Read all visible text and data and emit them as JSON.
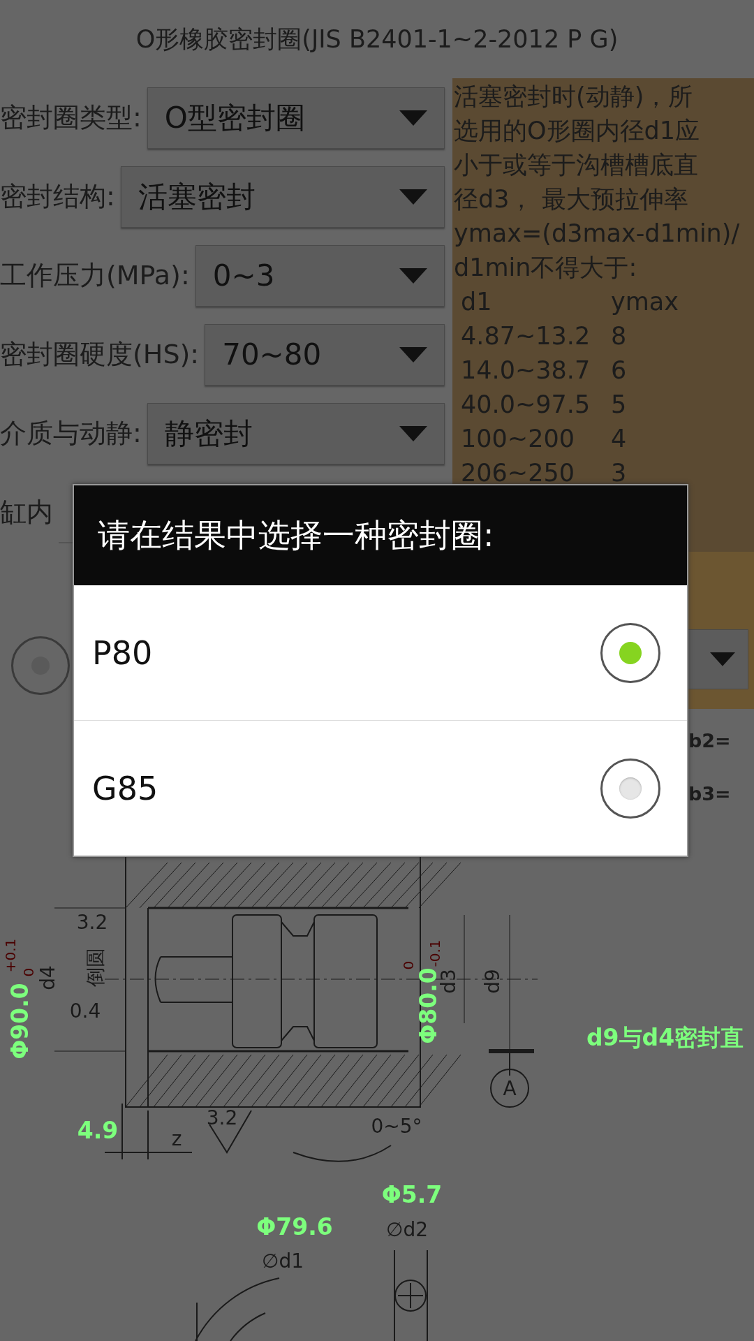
{
  "title": "O形橡胶密封圈(JIS B2401-1~2-2012 P G)",
  "form": [
    {
      "kind": "spinner",
      "label": "密封圈类型:",
      "value": "O型密封圈"
    },
    {
      "kind": "spinner",
      "label": "密封结构:",
      "value": "活塞密封"
    },
    {
      "kind": "spinner",
      "label": "工作压力(MPa):",
      "value": "0~3"
    },
    {
      "kind": "spinner",
      "label": "密封圈硬度(HS):",
      "value": "70~80"
    },
    {
      "kind": "spinner",
      "label": "介质与动静:",
      "value": "静密封"
    },
    {
      "kind": "input",
      "label": "缸内"
    }
  ],
  "radio_row": {
    "selected": false
  },
  "note": {
    "lines": [
      "活塞密封时(动静)，所",
      "选用的O形圈内径d1应",
      "小于或等于沟槽槽底直",
      "径d3， 最大预拉伸率",
      "ymax=(d3max-d1min)/",
      "d1min不得大于:"
    ],
    "table": [
      [
        "d1",
        "ymax"
      ],
      [
        "4.87~13.2",
        "8"
      ],
      [
        "14.0~38.7",
        "6"
      ],
      [
        "40.0~97.5",
        "5"
      ],
      [
        "100~200",
        "4"
      ],
      [
        "206~250",
        "3"
      ]
    ]
  },
  "side_texts": [
    "b2=",
    "b3="
  ],
  "drawing": {
    "green_labels": [
      "Φ90.0",
      "Φ80.0",
      "4.9",
      "Φ5.7",
      "Φ79.6"
    ],
    "tolerances": [
      "+0.1",
      "0",
      "0",
      "-0.1"
    ],
    "note_label": "d9与d4密封直",
    "labels": [
      "d4",
      "3.2",
      "倒圆",
      "0.4",
      "d3",
      "d9",
      "A",
      "z",
      "3.2",
      "0~5°",
      "∅d2",
      "∅d1"
    ]
  },
  "dialog": {
    "title": "请在结果中选择一种密封圈:",
    "options": [
      {
        "label": "P80",
        "selected": true
      },
      {
        "label": "G85",
        "selected": false
      }
    ]
  }
}
